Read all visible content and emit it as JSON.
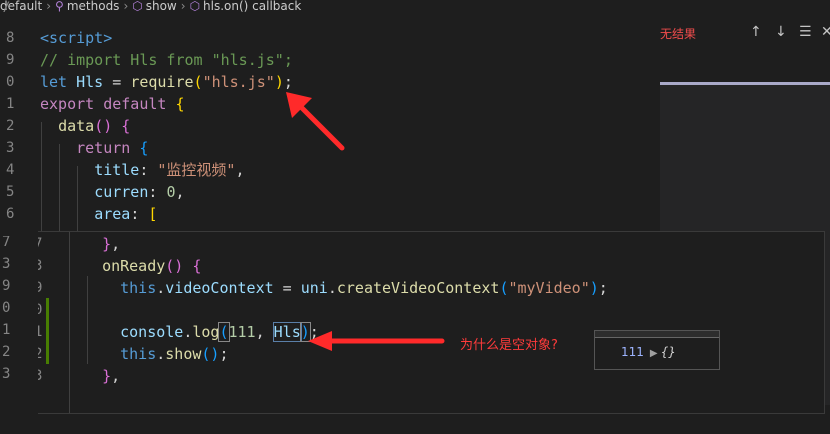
{
  "breadcrumb": {
    "items": [
      "default",
      "methods",
      "show",
      "hls.on() callback"
    ],
    "icons": [
      "wrench-icon",
      "cube-icon",
      "cube-icon"
    ]
  },
  "panel": {
    "title": "无结果",
    "icons": [
      "arrow-up-icon",
      "arrow-down-icon",
      "list-icon",
      "close-icon"
    ],
    "glyphs": [
      "↑",
      "↓",
      "☰",
      "✕"
    ]
  },
  "top_editor": {
    "gutter": [
      "8",
      "9",
      "0",
      "1",
      "2",
      "3",
      "4",
      "5",
      "6"
    ],
    "lines": [
      [
        {
          "c": "t-tag",
          "t": "<script>"
        }
      ],
      [
        {
          "c": "t-com",
          "t": "// import Hls from \"hls.js\";"
        }
      ],
      [
        {
          "c": "t-kw",
          "t": "let "
        },
        {
          "c": "t-var",
          "t": "Hls"
        },
        {
          "c": "t-pl",
          "t": " = "
        },
        {
          "c": "t-fn",
          "t": "require"
        },
        {
          "c": "t-p1",
          "t": "("
        },
        {
          "c": "t-str",
          "t": "\"hls.js\""
        },
        {
          "c": "t-p1",
          "t": ")"
        },
        {
          "c": "t-pl",
          "t": ";"
        }
      ],
      [
        {
          "c": "t-ctl",
          "t": "export default "
        },
        {
          "c": "t-p1",
          "t": "{"
        }
      ],
      [
        {
          "c": "t-pl",
          "t": "  "
        },
        {
          "c": "t-fn",
          "t": "data"
        },
        {
          "c": "t-p2",
          "t": "()"
        },
        {
          "c": "t-pl",
          "t": " "
        },
        {
          "c": "t-p2",
          "t": "{"
        }
      ],
      [
        {
          "c": "t-pl",
          "t": "    "
        },
        {
          "c": "t-ctl",
          "t": "return "
        },
        {
          "c": "t-p3",
          "t": "{"
        }
      ],
      [
        {
          "c": "t-pl",
          "t": "      "
        },
        {
          "c": "t-var",
          "t": "title"
        },
        {
          "c": "t-pl",
          "t": ": "
        },
        {
          "c": "t-str",
          "t": "\"监控视频\""
        },
        {
          "c": "t-pl",
          "t": ","
        }
      ],
      [
        {
          "c": "t-pl",
          "t": "      "
        },
        {
          "c": "t-var",
          "t": "curren"
        },
        {
          "c": "t-pl",
          "t": ": "
        },
        {
          "c": "t-num",
          "t": "0"
        },
        {
          "c": "t-pl",
          "t": ","
        }
      ],
      [
        {
          "c": "t-pl",
          "t": "      "
        },
        {
          "c": "t-var",
          "t": "area"
        },
        {
          "c": "t-pl",
          "t": ": "
        },
        {
          "c": "t-p1",
          "t": "["
        }
      ]
    ]
  },
  "bottom_editor": {
    "gutter": [
      "7",
      "3",
      "9",
      "0",
      "1",
      "2",
      "3"
    ],
    "lines": [
      [
        {
          "c": "t-pl",
          "t": "  "
        },
        {
          "c": "t-p2",
          "t": "}"
        },
        {
          "c": "t-pl",
          "t": ","
        }
      ],
      [
        {
          "c": "t-pl",
          "t": "  "
        },
        {
          "c": "t-fn",
          "t": "onReady"
        },
        {
          "c": "t-p2",
          "t": "()"
        },
        {
          "c": "t-pl",
          "t": " "
        },
        {
          "c": "t-p2",
          "t": "{"
        }
      ],
      [
        {
          "c": "t-pl",
          "t": "    "
        },
        {
          "c": "t-kw",
          "t": "this"
        },
        {
          "c": "t-pl",
          "t": "."
        },
        {
          "c": "t-var",
          "t": "videoContext"
        },
        {
          "c": "t-pl",
          "t": " = "
        },
        {
          "c": "t-var",
          "t": "uni"
        },
        {
          "c": "t-pl",
          "t": "."
        },
        {
          "c": "t-fn",
          "t": "createVideoContext"
        },
        {
          "c": "t-p3",
          "t": "("
        },
        {
          "c": "t-str",
          "t": "\"myVideo\""
        },
        {
          "c": "t-p3",
          "t": ")"
        },
        {
          "c": "t-pl",
          "t": ";"
        }
      ],
      [
        {
          "c": "t-pl",
          "t": ""
        }
      ],
      [
        {
          "c": "t-pl",
          "t": "    "
        },
        {
          "c": "t-var",
          "t": "console"
        },
        {
          "c": "t-pl",
          "t": "."
        },
        {
          "c": "t-fn",
          "t": "log"
        },
        {
          "c": "t-p3",
          "t": "("
        },
        {
          "c": "t-num",
          "t": "111"
        },
        {
          "c": "t-pl",
          "t": ", "
        },
        {
          "c": "t-var",
          "t": "Hls"
        },
        {
          "c": "t-p3",
          "t": ")"
        },
        {
          "c": "t-pl",
          "t": ";"
        }
      ],
      [
        {
          "c": "t-pl",
          "t": "    "
        },
        {
          "c": "t-kw",
          "t": "this"
        },
        {
          "c": "t-pl",
          "t": "."
        },
        {
          "c": "t-fn",
          "t": "show"
        },
        {
          "c": "t-p3",
          "t": "()"
        },
        {
          "c": "t-pl",
          "t": ";"
        }
      ],
      [
        {
          "c": "t-pl",
          "t": "  "
        },
        {
          "c": "t-p2",
          "t": "}"
        },
        {
          "c": "t-pl",
          "t": ","
        }
      ]
    ]
  },
  "left_gutter": [
    "/",
    "7",
    "3",
    "9",
    "0",
    "1",
    "2",
    "3"
  ],
  "annotation": {
    "question": "为什么是空对象?",
    "arrow_color": "#ff2a2a"
  },
  "console": {
    "value": "111",
    "object": "{}"
  },
  "colors": {
    "background": "#1e1e1e",
    "panel_title": "#f14c4c"
  }
}
